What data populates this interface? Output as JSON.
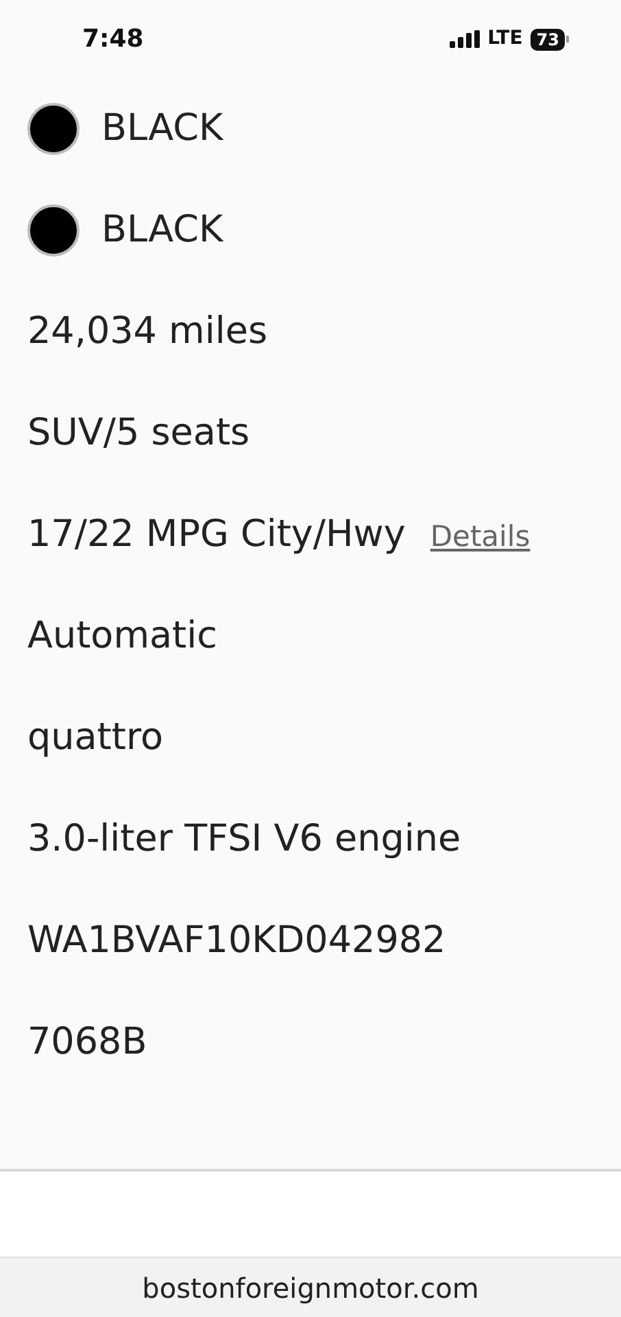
{
  "status_bar": {
    "time": "7:48",
    "network": "LTE",
    "battery": "73"
  },
  "specs": [
    {
      "kind": "color",
      "text": "BLACK",
      "color": "#000000"
    },
    {
      "kind": "color",
      "text": "BLACK",
      "color": "#000000"
    },
    {
      "kind": "text",
      "text": "24,034 miles"
    },
    {
      "kind": "text",
      "text": "SUV/5 seats"
    },
    {
      "kind": "link",
      "text": "17/22 MPG City/Hwy",
      "link": "Details"
    },
    {
      "kind": "text",
      "text": "Automatic"
    },
    {
      "kind": "text",
      "text": "quattro"
    },
    {
      "kind": "text",
      "text": "3.0-liter TFSI V6 engine"
    },
    {
      "kind": "text",
      "text": "WA1BVAF10KD042982"
    },
    {
      "kind": "text",
      "text": "7068B"
    }
  ],
  "address_bar": {
    "url": "bostonforeignmotor.com"
  }
}
